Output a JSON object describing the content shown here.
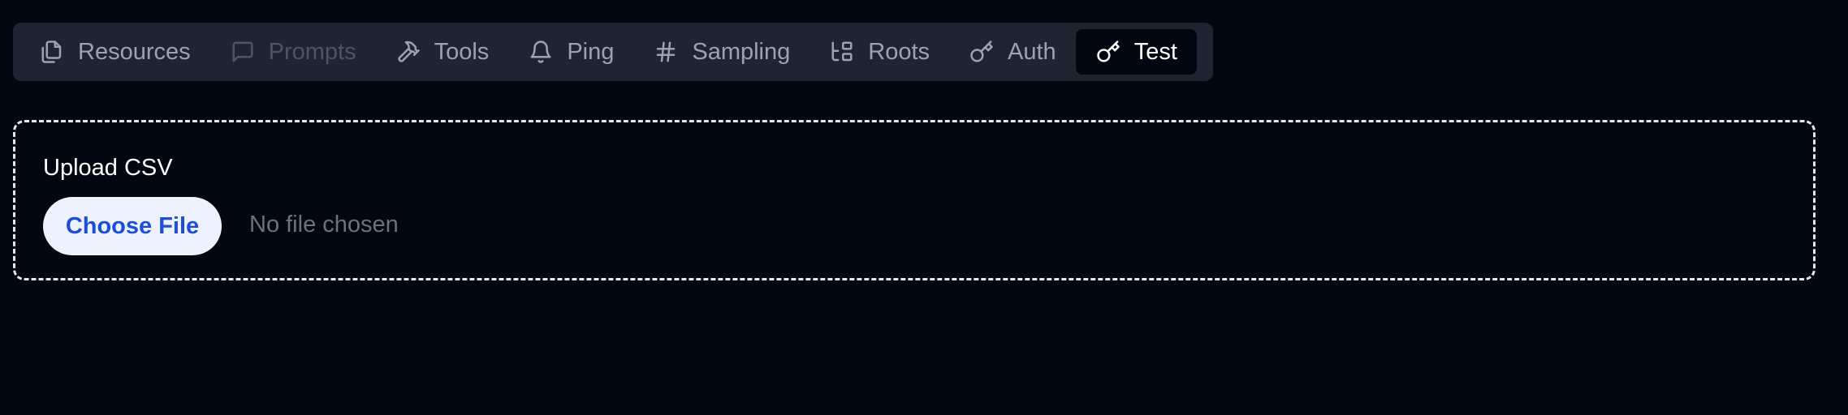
{
  "tabs": [
    {
      "label": "Resources",
      "icon": "files-icon",
      "state": "normal"
    },
    {
      "label": "Prompts",
      "icon": "message-square-icon",
      "state": "disabled"
    },
    {
      "label": "Tools",
      "icon": "hammer-icon",
      "state": "normal"
    },
    {
      "label": "Ping",
      "icon": "bell-icon",
      "state": "normal"
    },
    {
      "label": "Sampling",
      "icon": "hash-icon",
      "state": "normal"
    },
    {
      "label": "Roots",
      "icon": "folder-tree-icon",
      "state": "normal"
    },
    {
      "label": "Auth",
      "icon": "key-icon",
      "state": "normal"
    },
    {
      "label": "Test",
      "icon": "key-icon",
      "state": "active"
    }
  ],
  "upload": {
    "label": "Upload CSV",
    "button_label": "Choose File",
    "status": "No file chosen"
  },
  "colors": {
    "background": "#030712",
    "tabbar": "#1e2531",
    "active_tab": "#030712",
    "button_bg": "#eef2ff",
    "button_text": "#1d4ed8"
  }
}
